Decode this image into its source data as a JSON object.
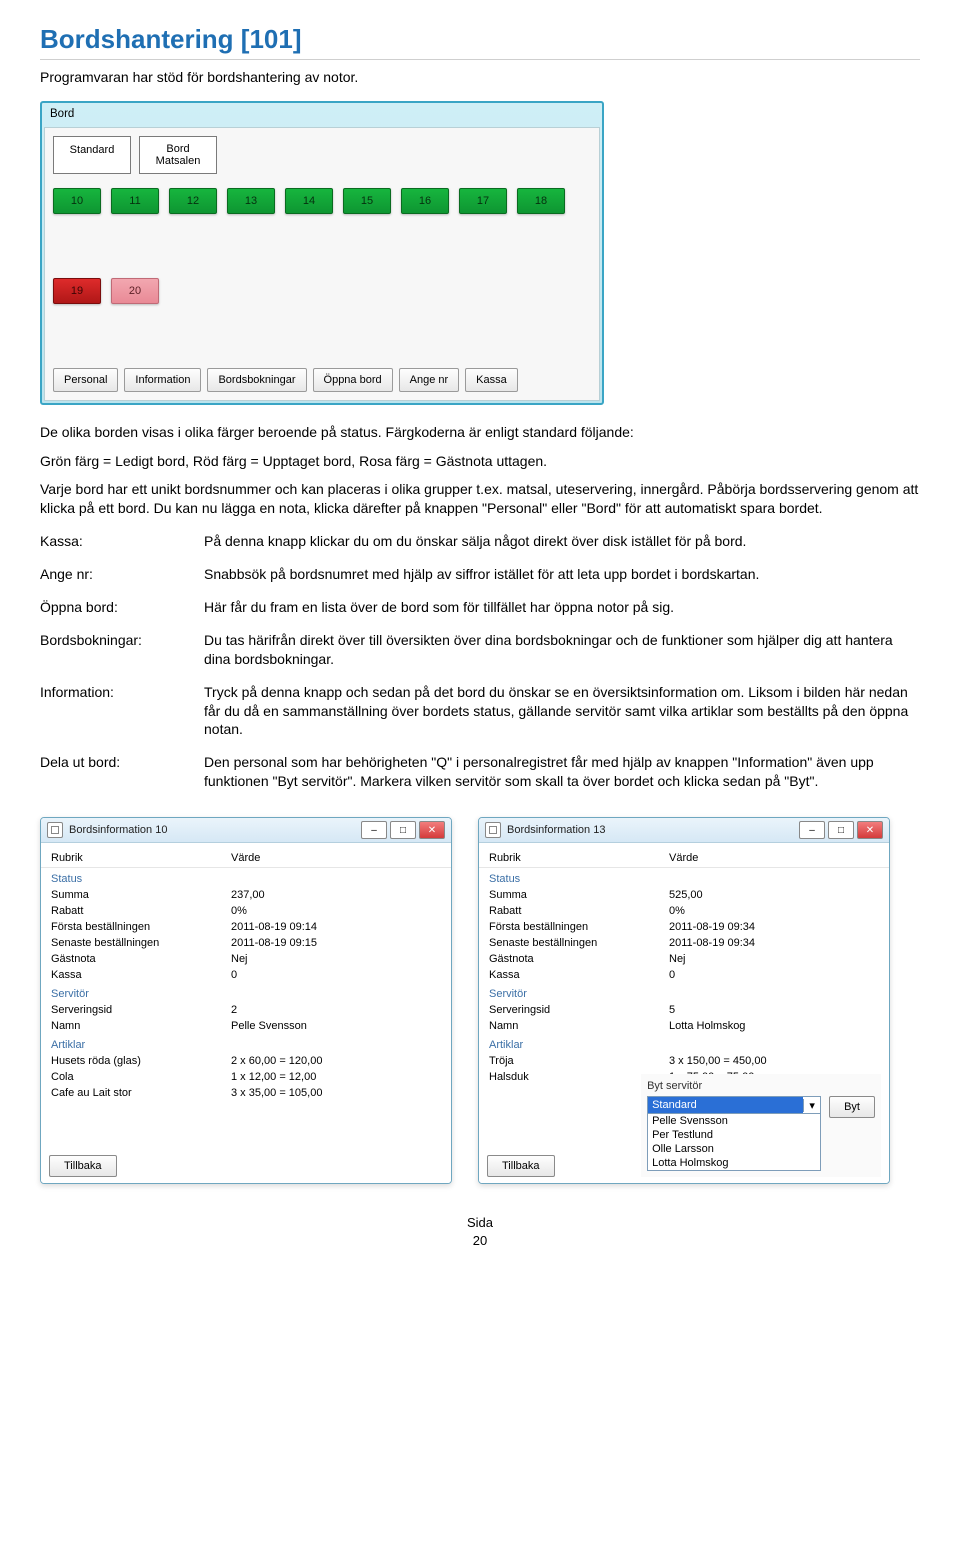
{
  "heading": "Bordshantering [101]",
  "lead": "Programvaran har stöd för bordshantering av notor.",
  "mainScreenshot": {
    "windowLabel": "Bord",
    "tabs": [
      "Standard",
      "Bord\nMatsalen"
    ],
    "tiles": [
      {
        "n": "10",
        "c": "green"
      },
      {
        "n": "11",
        "c": "green"
      },
      {
        "n": "12",
        "c": "green"
      },
      {
        "n": "13",
        "c": "green"
      },
      {
        "n": "14",
        "c": "green"
      },
      {
        "n": "15",
        "c": "green"
      },
      {
        "n": "16",
        "c": "green"
      },
      {
        "n": "17",
        "c": "green"
      },
      {
        "n": "18",
        "c": "green"
      },
      {
        "n": "19",
        "c": "red"
      },
      {
        "n": "20",
        "c": "rose"
      }
    ],
    "bottomButtons": [
      "Personal",
      "Information",
      "Bordsbokningar",
      "Öppna bord",
      "Ange nr",
      "Kassa"
    ]
  },
  "para1": "De olika borden visas i olika färger beroende på status. Färgkoderna är enligt standard följande:",
  "para2": "Grön färg = Ledigt bord, Röd färg = Upptaget bord, Rosa färg = Gästnota uttagen.",
  "para3": "Varje bord har ett unikt bordsnummer och kan placeras i olika grupper t.ex. matsal, uteservering, innergård. Påbörja bordsservering genom att klicka på ett bord. Du kan nu lägga en nota, klicka därefter på knappen \"Personal\" eller \"Bord\" för att automatiskt spara bordet.",
  "defs": [
    {
      "k": "Kassa:",
      "v": "På denna knapp klickar du om du önskar sälja något direkt över disk istället för på bord."
    },
    {
      "k": "Ange nr:",
      "v": "Snabbsök på bordsnumret med hjälp av siffror istället för att leta upp bordet i bordskartan."
    },
    {
      "k": "Öppna bord:",
      "v": "Här får du fram en lista över de bord som för tillfället har öppna notor på sig."
    },
    {
      "k": "Bordsbokningar:",
      "v": "Du tas härifrån direkt över till översikten över dina bordsbokningar och de funktioner som hjälper dig att hantera dina bordsbokningar."
    },
    {
      "k": "Information:",
      "v": "Tryck på denna knapp och sedan på det bord du önskar se en översiktsinformation om. Liksom i bilden här nedan får du då en sammanställning över bordets status, gällande servitör samt vilka artiklar som beställts på den öppna notan."
    },
    {
      "k": "Dela ut bord:",
      "v": "Den personal som har behörigheten \"Q\" i personalregistret får med hjälp av knappen \"Information\" även upp funktionen \"Byt servitör\". Markera vilken servitör som skall ta över bordet och klicka sedan på \"Byt\"."
    }
  ],
  "dialogCommon": {
    "colRubrik": "Rubrik",
    "colVarde": "Värde",
    "secStatus": "Status",
    "secServitor": "Servitör",
    "secArtiklar": "Artiklar",
    "kSumma": "Summa",
    "kRabatt": "Rabatt",
    "kForsta": "Första beställningen",
    "kSenaste": "Senaste beställningen",
    "kGastnota": "Gästnota",
    "kKassa": "Kassa",
    "kServId": "Serveringsid",
    "kNamn": "Namn",
    "btnTillbaka": "Tillbaka"
  },
  "dlgA": {
    "title": "Bordsinformation 10",
    "summa": "237,00",
    "rabatt": "0%",
    "forsta": "2011-08-19 09:14",
    "senaste": "2011-08-19 09:15",
    "gastnota": "Nej",
    "kassa": "0",
    "servId": "2",
    "namn": "Pelle Svensson",
    "artiklar": [
      {
        "n": "Husets röda (glas)",
        "c": "2 x 60,00 = 120,00"
      },
      {
        "n": "Cola",
        "c": "1 x 12,00 = 12,00"
      },
      {
        "n": "Cafe au Lait stor",
        "c": "3 x 35,00 = 105,00"
      }
    ]
  },
  "dlgB": {
    "title": "Bordsinformation 13",
    "summa": "525,00",
    "rabatt": "0%",
    "forsta": "2011-08-19 09:34",
    "senaste": "2011-08-19 09:34",
    "gastnota": "Nej",
    "kassa": "0",
    "servId": "5",
    "namn": "Lotta Holmskog",
    "artiklar": [
      {
        "n": "Tröja",
        "c": "3 x 150,00 = 450,00"
      },
      {
        "n": "Halsduk",
        "c": "1 x 75,00 = 75,00"
      }
    ],
    "bytLabel": "Byt servitör",
    "bytSelected": "Standard",
    "bytOptions": [
      "Pelle Svensson",
      "Per Testlund",
      "Olle Larsson",
      "Lotta Holmskog"
    ],
    "bytBtn": "Byt"
  },
  "footer": {
    "l1": "Sida",
    "l2": "20"
  }
}
